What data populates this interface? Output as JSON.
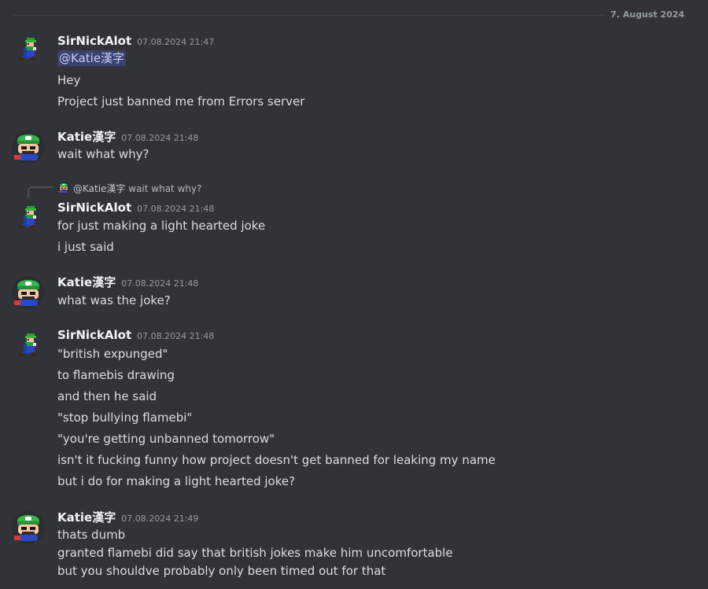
{
  "date_divider": "7. August 2024",
  "messages": [
    {
      "author": "SirNickAlot",
      "time": "07.08.2024 21:47",
      "mention": "@Katie漢字",
      "lines": [
        "Hey",
        "Project just banned me from Errors server"
      ]
    },
    {
      "author": "Katie漢字",
      "time": "07.08.2024 21:48",
      "lines": [
        "wait what why?"
      ]
    },
    {
      "reply": {
        "user": "@Katie漢字",
        "text": "wait what why?"
      },
      "author": "SirNickAlot",
      "time": "07.08.2024 21:48",
      "lines": [
        "for just making a light hearted joke",
        "i just said"
      ]
    },
    {
      "author": "Katie漢字",
      "time": "07.08.2024 21:48",
      "lines": [
        "what was the joke?"
      ]
    },
    {
      "author": "SirNickAlot",
      "time": "07.08.2024 21:48",
      "lines": [
        "\"british expunged\"",
        "to flamebis drawing",
        "and then he said",
        "\"stop bullying flamebi\"",
        "\"you're getting unbanned tomorrow\"",
        "isn't it fucking funny how project doesn't get banned for leaking my name",
        "but i do for making a light hearted joke?"
      ]
    },
    {
      "author": "Katie漢字",
      "time": "07.08.2024 21:49",
      "lines": [
        "thats dumb",
        "granted flamebi did say that british jokes make him uncomfortable",
        "but you shouldve probably only been timed out for that"
      ]
    }
  ],
  "colors": {
    "background": "#313338",
    "text": "#dbdee1",
    "username": "#f2f3f5",
    "muted": "#949ba4",
    "mention_bg": "#3c4270",
    "mention_text": "#c9cdfb"
  }
}
